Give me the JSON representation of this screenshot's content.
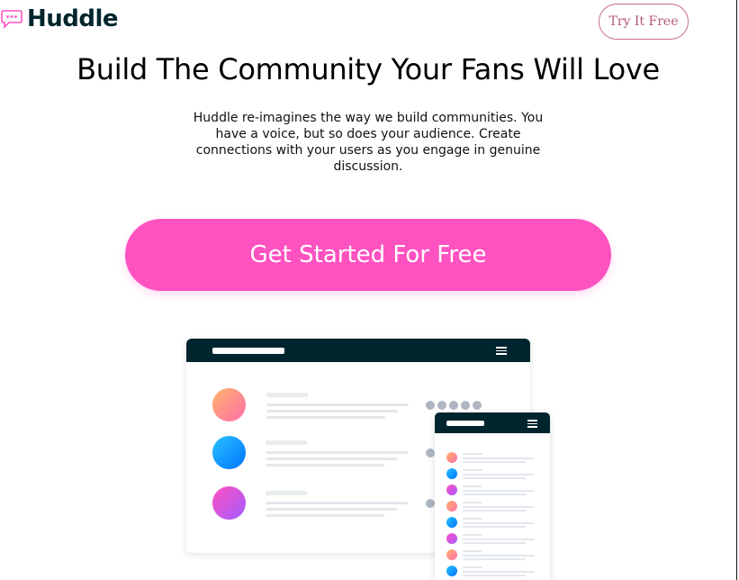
{
  "header": {
    "brand": "Huddle",
    "try_label": "Try It Free"
  },
  "hero": {
    "title": "Build The Community Your Fans Will Love",
    "description": "Huddle re-imagines the way we build communities. You have a voice, but so does your audience. Create connections with your users as you engage in genuine discussion.",
    "cta_label": "Get Started For Free"
  },
  "colors": {
    "brand_dark": "#00252e",
    "accent_pink": "#ff52c1",
    "outline_pink": "#c96a93"
  },
  "illustration": {
    "icons": [
      "chat-bubble-icon",
      "menu-icon"
    ]
  }
}
